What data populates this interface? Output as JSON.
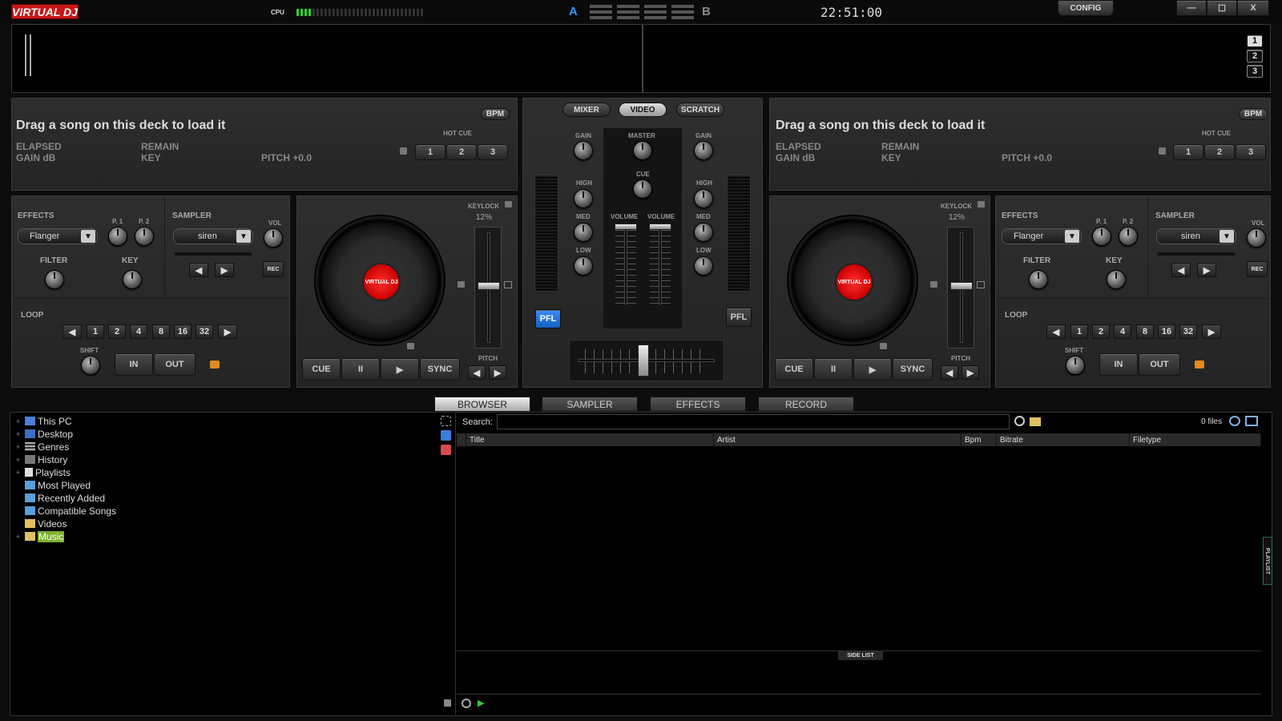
{
  "app": {
    "logo": "VIRTUAL DJ",
    "cpu_label": "CPU",
    "deck_a_letter": "A",
    "deck_b_letter": "B",
    "clock": "22:51:00",
    "config_label": "CONFIG"
  },
  "window": {
    "minimize": "—",
    "maximize": "☐",
    "close": "X"
  },
  "overview": {
    "page_buttons": [
      "1",
      "2",
      "3"
    ]
  },
  "deck_left": {
    "message": "Drag a song on this deck to load it",
    "bpm_label": "BPM",
    "elapsed": "ELAPSED",
    "remain": "REMAIN",
    "gain": "GAIN dB",
    "key": "KEY",
    "pitch": "PITCH +0.0",
    "hotcue_label": "HOT CUE",
    "hotcues": [
      "1",
      "2",
      "3"
    ],
    "effects_label": "EFFECTS",
    "effect": "Flanger",
    "p1": "P. 1",
    "p2": "P. 2",
    "sampler_label": "SAMPLER",
    "sample": "siren",
    "vol": "VOL",
    "rec": "REC",
    "filter": "FILTER",
    "key_knob": "KEY",
    "loop_label": "LOOP",
    "loops": [
      "1",
      "2",
      "4",
      "8",
      "16",
      "32"
    ],
    "shift": "SHIFT",
    "in": "IN",
    "out": "OUT",
    "keylock": "KEYLOCK",
    "pitch_range": "12%",
    "pitch_label": "PITCH",
    "cue": "CUE",
    "pause": "II",
    "play": "▶",
    "sync": "SYNC"
  },
  "deck_right": {
    "message": "Drag a song on this deck to load it",
    "bpm_label": "BPM",
    "elapsed": "ELAPSED",
    "remain": "REMAIN",
    "gain": "GAIN dB",
    "key": "KEY",
    "pitch": "PITCH +0.0",
    "hotcue_label": "HOT CUE",
    "hotcues": [
      "1",
      "2",
      "3"
    ],
    "effects_label": "EFFECTS",
    "effect": "Flanger",
    "p1": "P. 1",
    "p2": "P. 2",
    "sampler_label": "SAMPLER",
    "sample": "siren",
    "vol": "VOL",
    "rec": "REC",
    "filter": "FILTER",
    "key_knob": "KEY",
    "loop_label": "LOOP",
    "loops": [
      "1",
      "2",
      "4",
      "8",
      "16",
      "32"
    ],
    "shift": "SHIFT",
    "in": "IN",
    "out": "OUT",
    "keylock": "KEYLOCK",
    "pitch_range": "12%",
    "pitch_label": "PITCH",
    "cue": "CUE",
    "pause": "II",
    "play": "▶",
    "sync": "SYNC"
  },
  "mixer": {
    "tabs": [
      "MIXER",
      "VIDEO",
      "SCRATCH"
    ],
    "gain": "GAIN",
    "master": "MASTER",
    "cue": "CUE",
    "high": "HIGH",
    "med": "MED",
    "low": "LOW",
    "volume": "VOLUME",
    "pfl": "PFL"
  },
  "browser_tabs": [
    "BROWSER",
    "SAMPLER",
    "EFFECTS",
    "RECORD"
  ],
  "tree": [
    {
      "label": "This PC",
      "expander": "+",
      "icon": "pc-icon"
    },
    {
      "label": "Desktop",
      "expander": "+",
      "icon": "desktop-icon"
    },
    {
      "label": "Genres",
      "expander": "+",
      "icon": "genres-icon"
    },
    {
      "label": "History",
      "expander": "+",
      "icon": "history-icon"
    },
    {
      "label": "Playlists",
      "expander": "+",
      "icon": "playlist-icon"
    },
    {
      "label": "Most Played",
      "expander": "",
      "icon": "virtual-folder-icon"
    },
    {
      "label": "Recently Added",
      "expander": "",
      "icon": "virtual-folder-icon"
    },
    {
      "label": "Compatible Songs",
      "expander": "",
      "icon": "virtual-folder-icon"
    },
    {
      "label": "Videos",
      "expander": "",
      "icon": "folder-icon"
    },
    {
      "label": "Music",
      "expander": "+",
      "icon": "folder-icon"
    }
  ],
  "search": {
    "label": "Search:",
    "value": "",
    "files": "0 files"
  },
  "columns": [
    "Title",
    "Artist",
    "Bpm",
    "Bitrate",
    "Filetype"
  ],
  "side_list": "SIDE LIST",
  "playlist_tab": "PLAYLIST"
}
